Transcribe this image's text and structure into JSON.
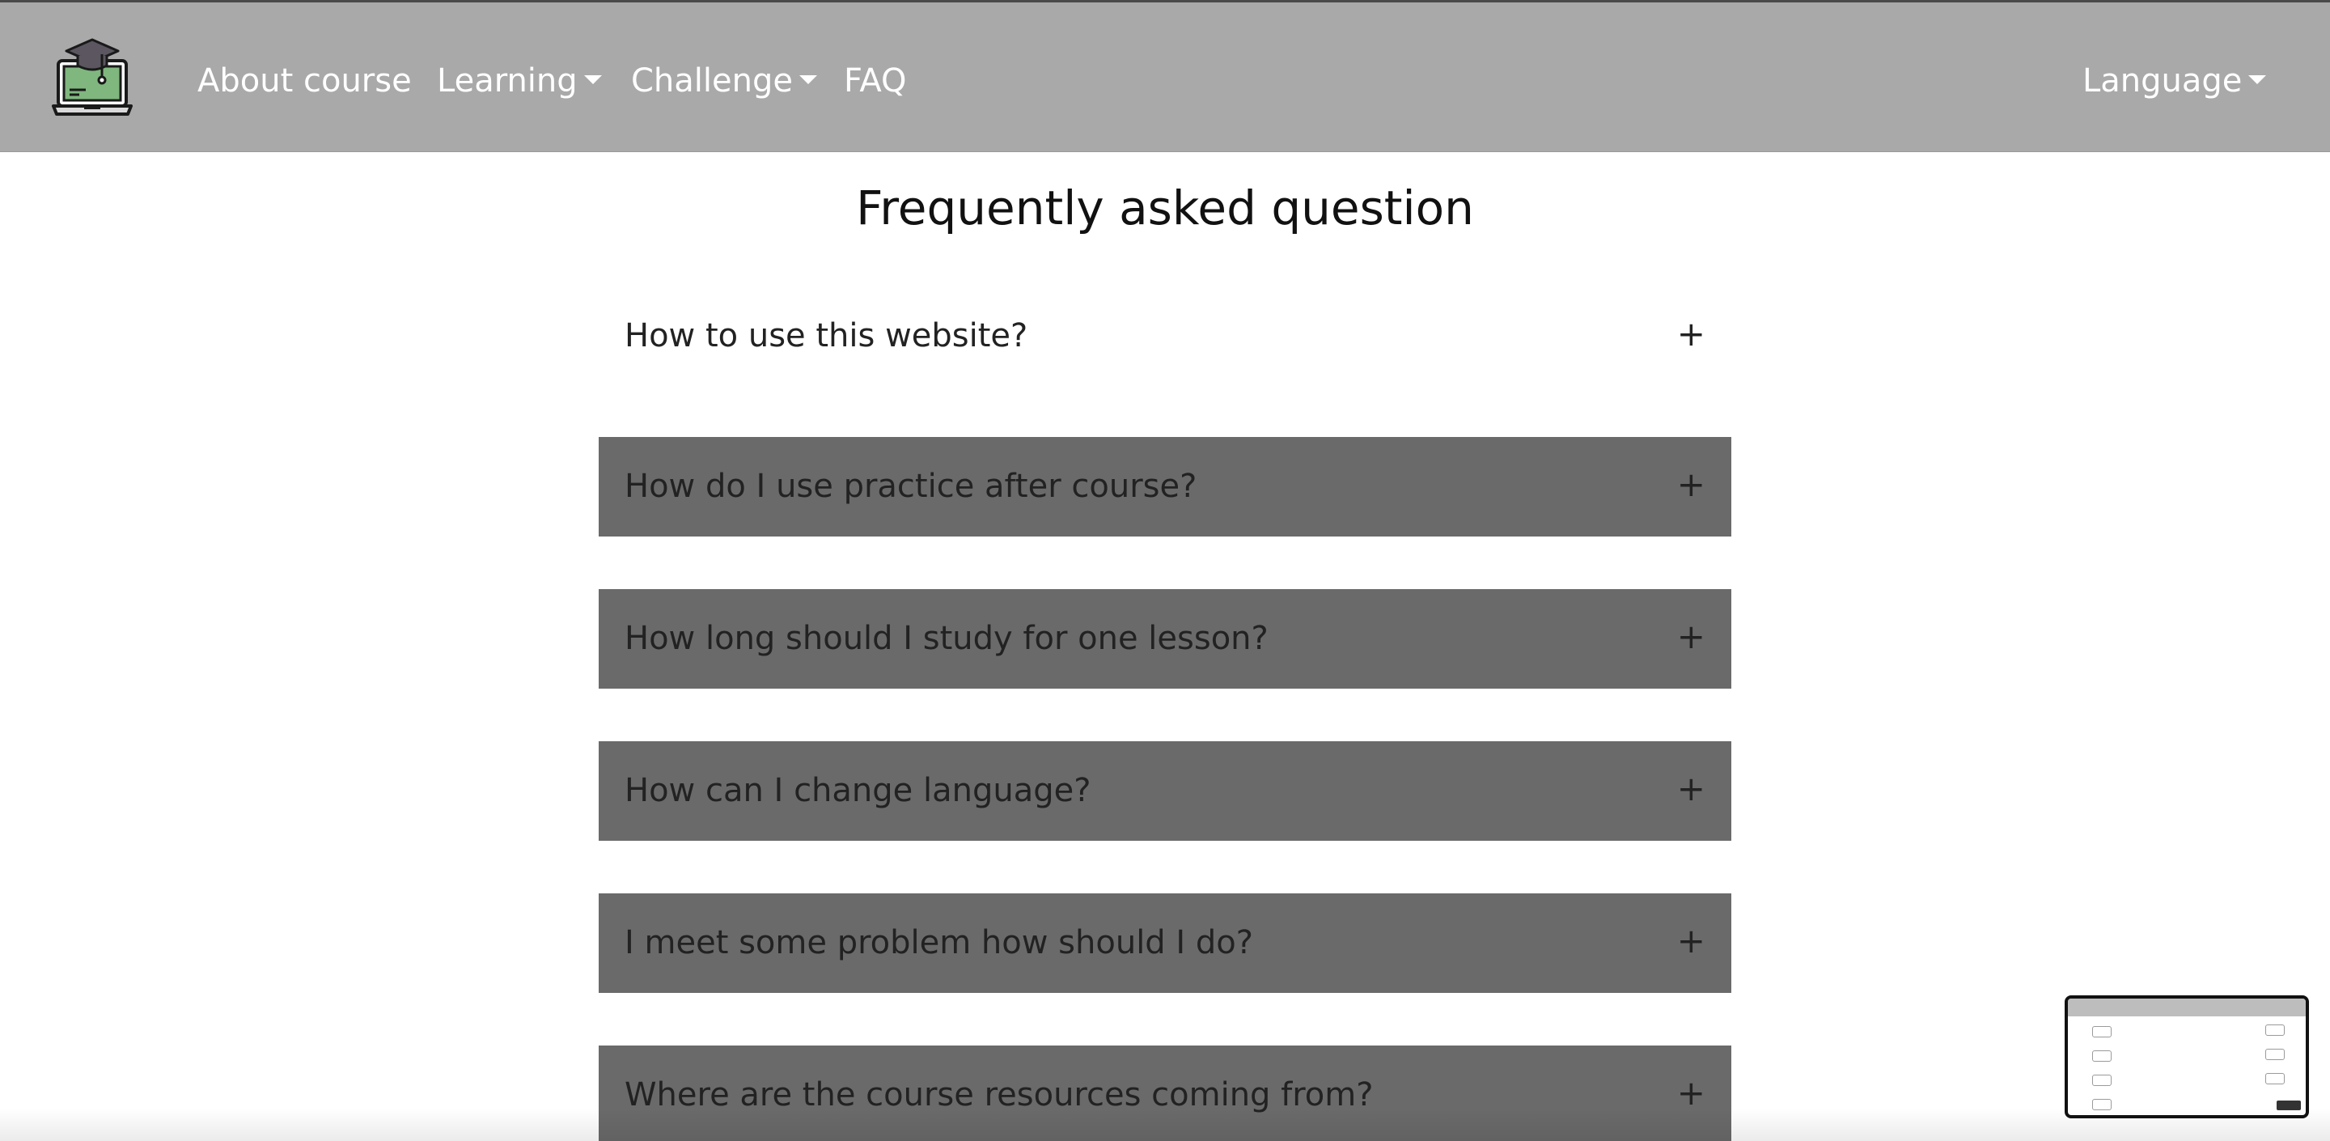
{
  "navbar": {
    "logo_icon": "laptop-graduation-cap-icon",
    "links": [
      {
        "label": "About course",
        "dropdown": false
      },
      {
        "label": "Learning",
        "dropdown": true
      },
      {
        "label": "Challenge",
        "dropdown": true
      },
      {
        "label": "FAQ",
        "dropdown": false
      }
    ],
    "language_label": "Language",
    "colors": {
      "background": "#a9a9a9",
      "text": "#ffffff"
    }
  },
  "page": {
    "title": "Frequently asked question"
  },
  "faq": {
    "expand_icon": "+",
    "items": [
      {
        "question": "How to use this website?"
      },
      {
        "question": "How do I use practice after course?"
      },
      {
        "question": "How long should I study for one lesson?"
      },
      {
        "question": "How can I change language?"
      },
      {
        "question": "I meet some problem how should I do?"
      },
      {
        "question": "Where are the course resources coming from?"
      }
    ],
    "colors": {
      "item_background": "#6a6a6a",
      "text": "#222222"
    }
  },
  "preview_thumbnail": {
    "icon": "page-preview-minimap-icon"
  }
}
